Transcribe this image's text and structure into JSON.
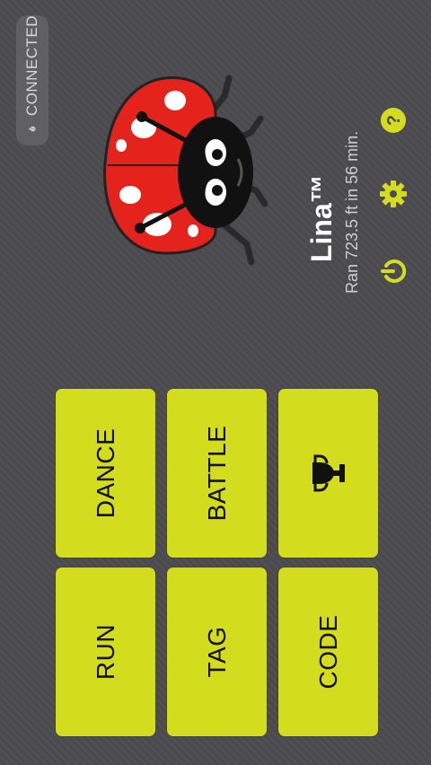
{
  "status": {
    "label": "CONNECTED",
    "icon": "bug-icon"
  },
  "robot": {
    "name": "Lina™",
    "stats": "Ran 723.5 ft in 56 min."
  },
  "header_icons": {
    "power": "power-icon",
    "settings": "gear-icon",
    "help": "help-icon"
  },
  "buttons": {
    "dance": "DANCE",
    "battle": "BATTLE",
    "trophy_icon": "trophy-icon",
    "run": "RUN",
    "tag": "TAG",
    "code": "CODE"
  },
  "colors": {
    "accent": "#d4dc1e",
    "background": "#4b4b4f",
    "ladybug_red": "#e5231d"
  }
}
